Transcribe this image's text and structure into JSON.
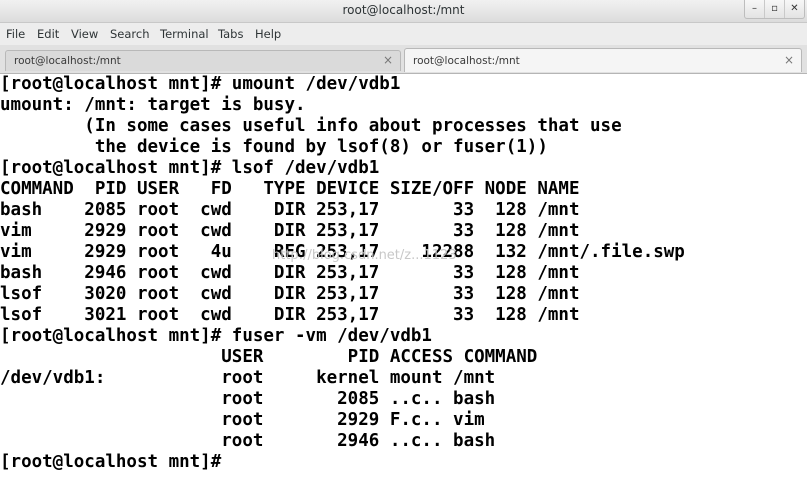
{
  "window": {
    "title": "root@localhost:/mnt",
    "buttons": {
      "minimize": "–",
      "maximize": "▫",
      "close": "✕"
    }
  },
  "menu": [
    "File",
    "Edit",
    "View",
    "Search",
    "Terminal",
    "Tabs",
    "Help"
  ],
  "tabs": [
    {
      "label": "root@localhost:/mnt",
      "close": "×",
      "active": false
    },
    {
      "label": "root@localhost:/mnt",
      "close": "×",
      "active": true
    }
  ],
  "terminal": {
    "lines": [
      "[root@localhost mnt]# umount /dev/vdb1",
      "umount: /mnt: target is busy.",
      "        (In some cases useful info about processes that use",
      "         the device is found by lsof(8) or fuser(1))",
      "[root@localhost mnt]# lsof /dev/vdb1",
      "COMMAND  PID USER   FD   TYPE DEVICE SIZE/OFF NODE NAME",
      "bash    2085 root  cwd    DIR 253,17       33  128 /mnt",
      "vim     2929 root  cwd    DIR 253,17       33  128 /mnt",
      "vim     2929 root   4u    REG 253,17    12288  132 /mnt/.file.swp",
      "bash    2946 root  cwd    DIR 253,17       33  128 /mnt",
      "lsof    3020 root  cwd    DIR 253,17       33  128 /mnt",
      "lsof    3021 root  cwd    DIR 253,17       33  128 /mnt",
      "[root@localhost mnt]# fuser -vm /dev/vdb1",
      "                     USER        PID ACCESS COMMAND",
      "/dev/vdb1:           root     kernel mount /mnt",
      "                     root       2085 ..c.. bash",
      "                     root       2929 F.c.. vim",
      "                     root       2946 ..c.. bash",
      "[root@localhost mnt]#"
    ],
    "watermark": "http://blog.csdn.net/z...1123"
  }
}
